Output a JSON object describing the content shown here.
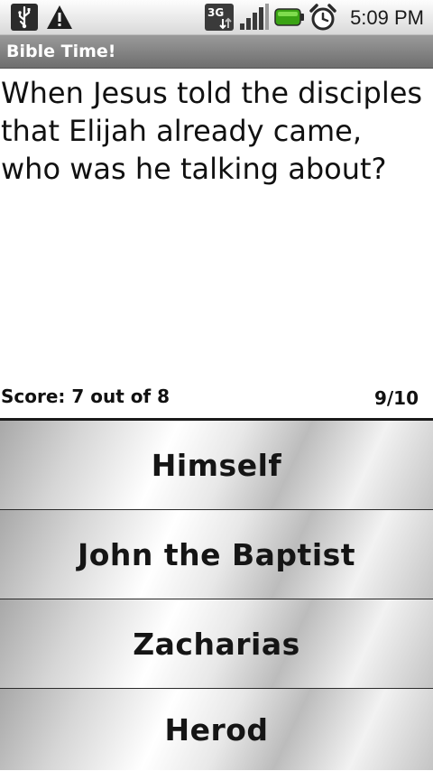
{
  "status_bar": {
    "time": "5:09 PM",
    "icons": [
      "usb-icon",
      "warning-icon",
      "3g-icon",
      "signal-icon",
      "battery-icon",
      "alarm-icon"
    ],
    "network_label": "3G"
  },
  "app": {
    "title": "Bible Time!"
  },
  "quiz": {
    "question": "When Jesus told the disciples that Elijah already came, who was he talking about?",
    "score": "Score: 7 out of 8",
    "progress": "9/10",
    "answers": [
      {
        "label": "Himself"
      },
      {
        "label": "John the Baptist"
      },
      {
        "label": "Zacharias"
      },
      {
        "label": "Herod"
      }
    ]
  },
  "colors": {
    "title_bar": "#7f7f7f",
    "status_bar": "#e8e8e8",
    "battery": "#4caf1a",
    "text": "#111111"
  }
}
